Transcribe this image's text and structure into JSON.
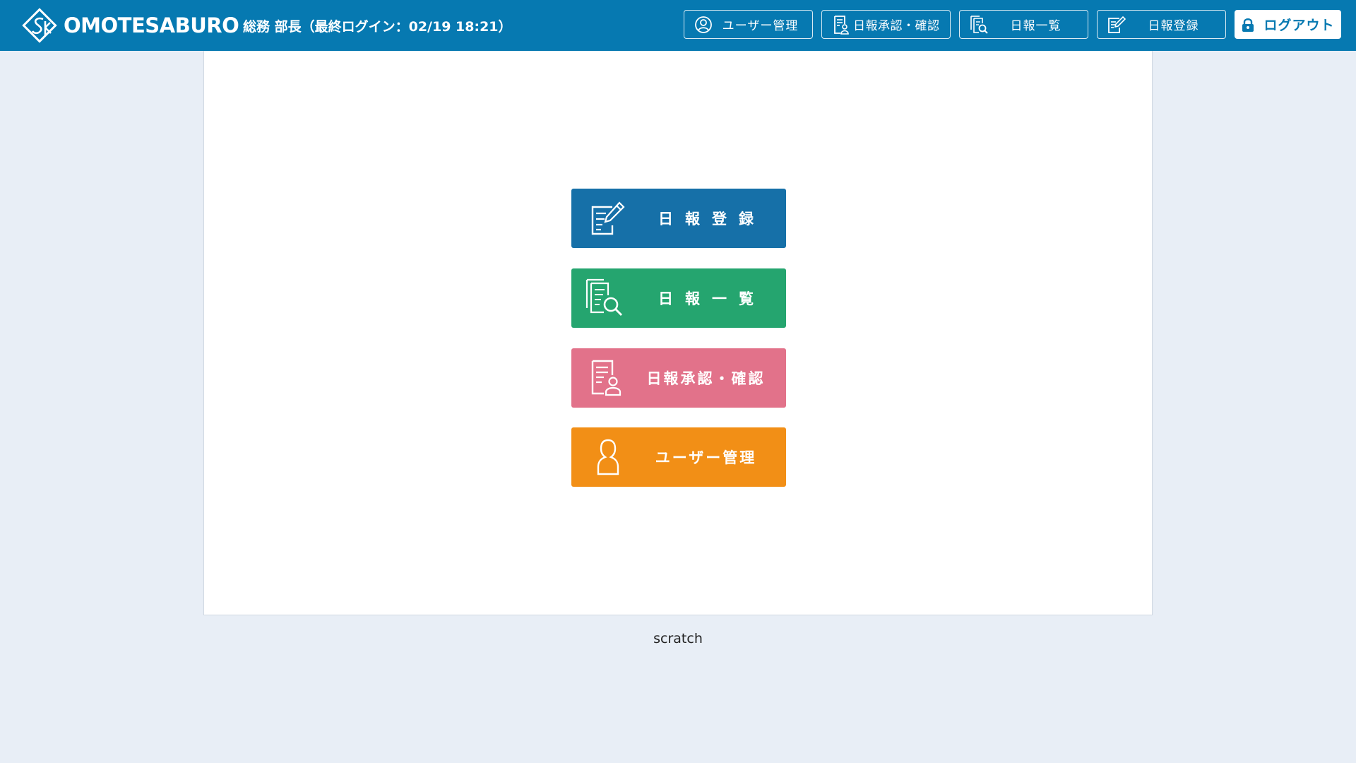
{
  "header": {
    "brand": "OMOTESABURO",
    "user_info": "総務 部長（最終ログイン：02/19 18:21）",
    "nav": {
      "user_mgmt": "ユーザー管理",
      "approval": "日報承認・確認",
      "list": "日報一覧",
      "register": "日報登録"
    },
    "logout": "ログアウト"
  },
  "menu": {
    "register": "日報登録",
    "list": "日報一覧",
    "approval": "日報承認・確認",
    "user_mgmt": "ユーザー管理"
  },
  "footer": {
    "text": "scratch"
  },
  "colors": {
    "header_bg": "#0679b1",
    "page_bg": "#e8eef6",
    "register": "#1670a8",
    "list": "#25a56f",
    "approval": "#e2728a",
    "user_mgmt": "#f28f16"
  },
  "icons": {
    "brand": "sk-diamond-logo",
    "user_mgmt": "user-icon",
    "approval": "document-person-icon",
    "list": "documents-search-icon",
    "register": "document-edit-icon",
    "logout": "lock-icon"
  }
}
